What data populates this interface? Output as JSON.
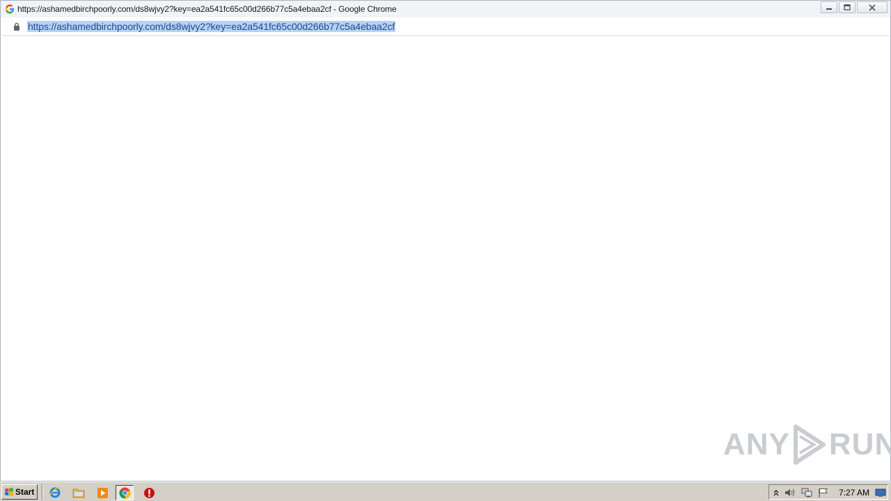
{
  "window": {
    "title": "https://ashamedbirchpoorly.com/ds8wjvy2?key=ea2a541fc65c00d266b77c5a4ebaa2cf - Google Chrome"
  },
  "addressbar": {
    "url": "https://ashamedbirchpoorly.com/ds8wjvy2?key=ea2a541fc65c00d266b77c5a4ebaa2cf"
  },
  "watermark": {
    "left": "ANY",
    "right": "RUN"
  },
  "taskbar": {
    "start_label": "Start",
    "clock": "7:27 AM",
    "pinned": [
      "internet-explorer-icon",
      "file-explorer-icon",
      "media-player-icon",
      "chrome-icon",
      "antivirus-alert-icon"
    ]
  },
  "colors": {
    "url_highlight": "#b9d2f3",
    "taskbar_bg": "#d4d0c8",
    "titlebar_bg": "#f1f3f6"
  }
}
